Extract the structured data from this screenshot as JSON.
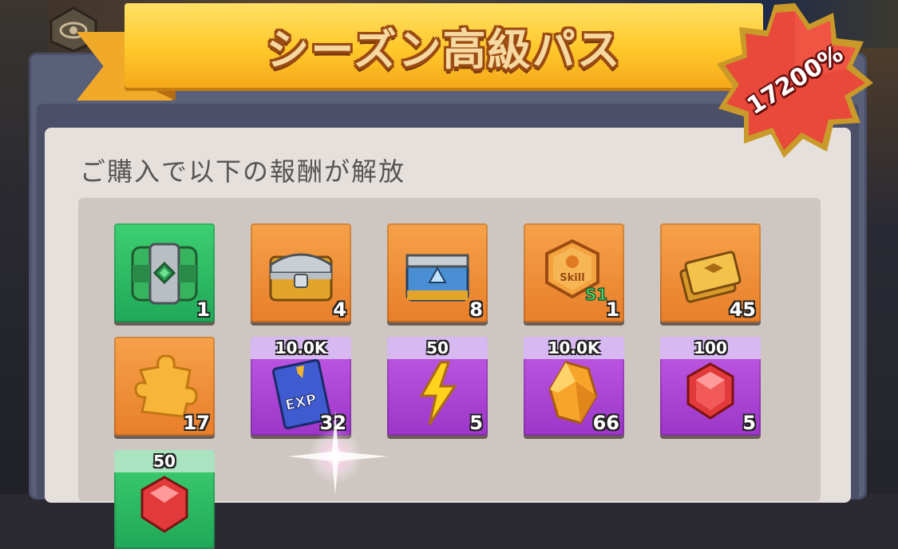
{
  "colors": {
    "banner": "#ffc82a",
    "burst": "#e8493a",
    "tile_orange": "#f29040",
    "tile_green": "#2fbf66",
    "tile_purple": "#b048d8",
    "card": "#e6e0dc"
  },
  "header": {
    "title": "シーズン高級パス",
    "bonus_badge": "17200%"
  },
  "content": {
    "subtitle": "ご購入で以下の報酬が解放"
  },
  "rewards": [
    {
      "icon": "green-supply-crate-icon",
      "count": "1",
      "band": ""
    },
    {
      "icon": "silver-gold-chest-icon",
      "count": "4",
      "band": ""
    },
    {
      "icon": "blue-gold-chest-icon",
      "count": "8",
      "band": ""
    },
    {
      "icon": "skill-s1-token-icon",
      "count": "1",
      "band": "",
      "label": "S1"
    },
    {
      "icon": "gold-tickets-icon",
      "count": "45",
      "band": ""
    },
    {
      "icon": "puzzle-piece-icon",
      "count": "17",
      "band": ""
    },
    {
      "icon": "exp-book-icon",
      "count": "32",
      "band": "10.0K",
      "label": "EXP"
    },
    {
      "icon": "lightning-energy-icon",
      "count": "5",
      "band": "50"
    },
    {
      "icon": "orange-crystal-icon",
      "count": "66",
      "band": "10.0K"
    },
    {
      "icon": "red-gem-icon",
      "count": "5",
      "band": "100"
    },
    {
      "icon": "red-gem-icon",
      "count": "",
      "band": "50"
    }
  ]
}
